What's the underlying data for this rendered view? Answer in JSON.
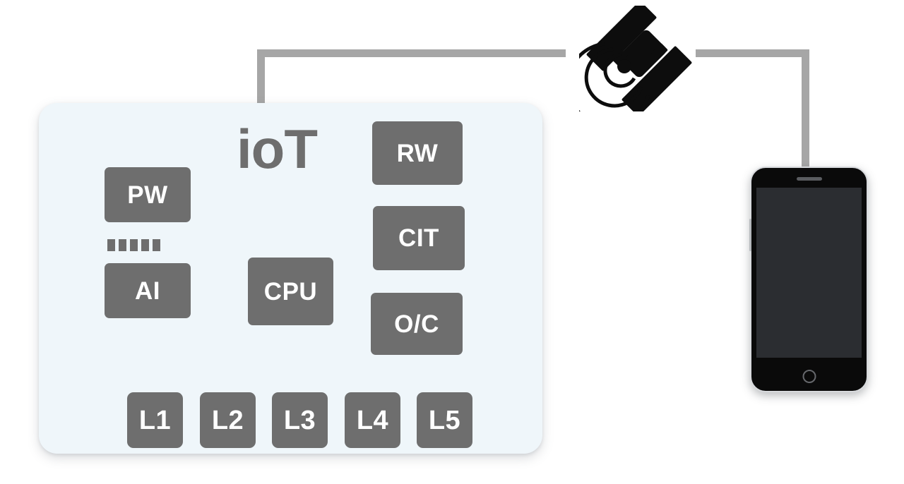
{
  "diagram": {
    "title": "IoT device connected via satellite to smartphone",
    "colors": {
      "card_background": "#eff6fa",
      "module_fill": "#6e6e6e",
      "module_text": "#ffffff",
      "connector": "#a6a6a6",
      "satellite": "#0d0d0d",
      "phone_body": "#0a0a0a",
      "phone_screen": "#2b2d31",
      "page_background": "#ffffff"
    }
  },
  "iot_card": {
    "title": "ioT",
    "left_column": {
      "power_module": "PW",
      "ai_module": "AI",
      "separator_dots": 5
    },
    "center_column": {
      "cpu_module": "CPU"
    },
    "right_column": {
      "rw_module": "RW",
      "cit_module": "CIT",
      "oc_module": "O/C"
    },
    "bottom_row": [
      "L1",
      "L2",
      "L3",
      "L4",
      "L5"
    ]
  },
  "satellite": {
    "icon": "satellite-icon",
    "signal_waves": 3
  },
  "phone": {
    "icon": "smartphone-icon",
    "speaker": "earpiece-speaker",
    "home_button": "home-button",
    "volume_button": "volume-button",
    "screen_state": ""
  },
  "connectors": {
    "iot_to_satellite": "link-line-left",
    "satellite_to_phone": "link-line-right"
  }
}
